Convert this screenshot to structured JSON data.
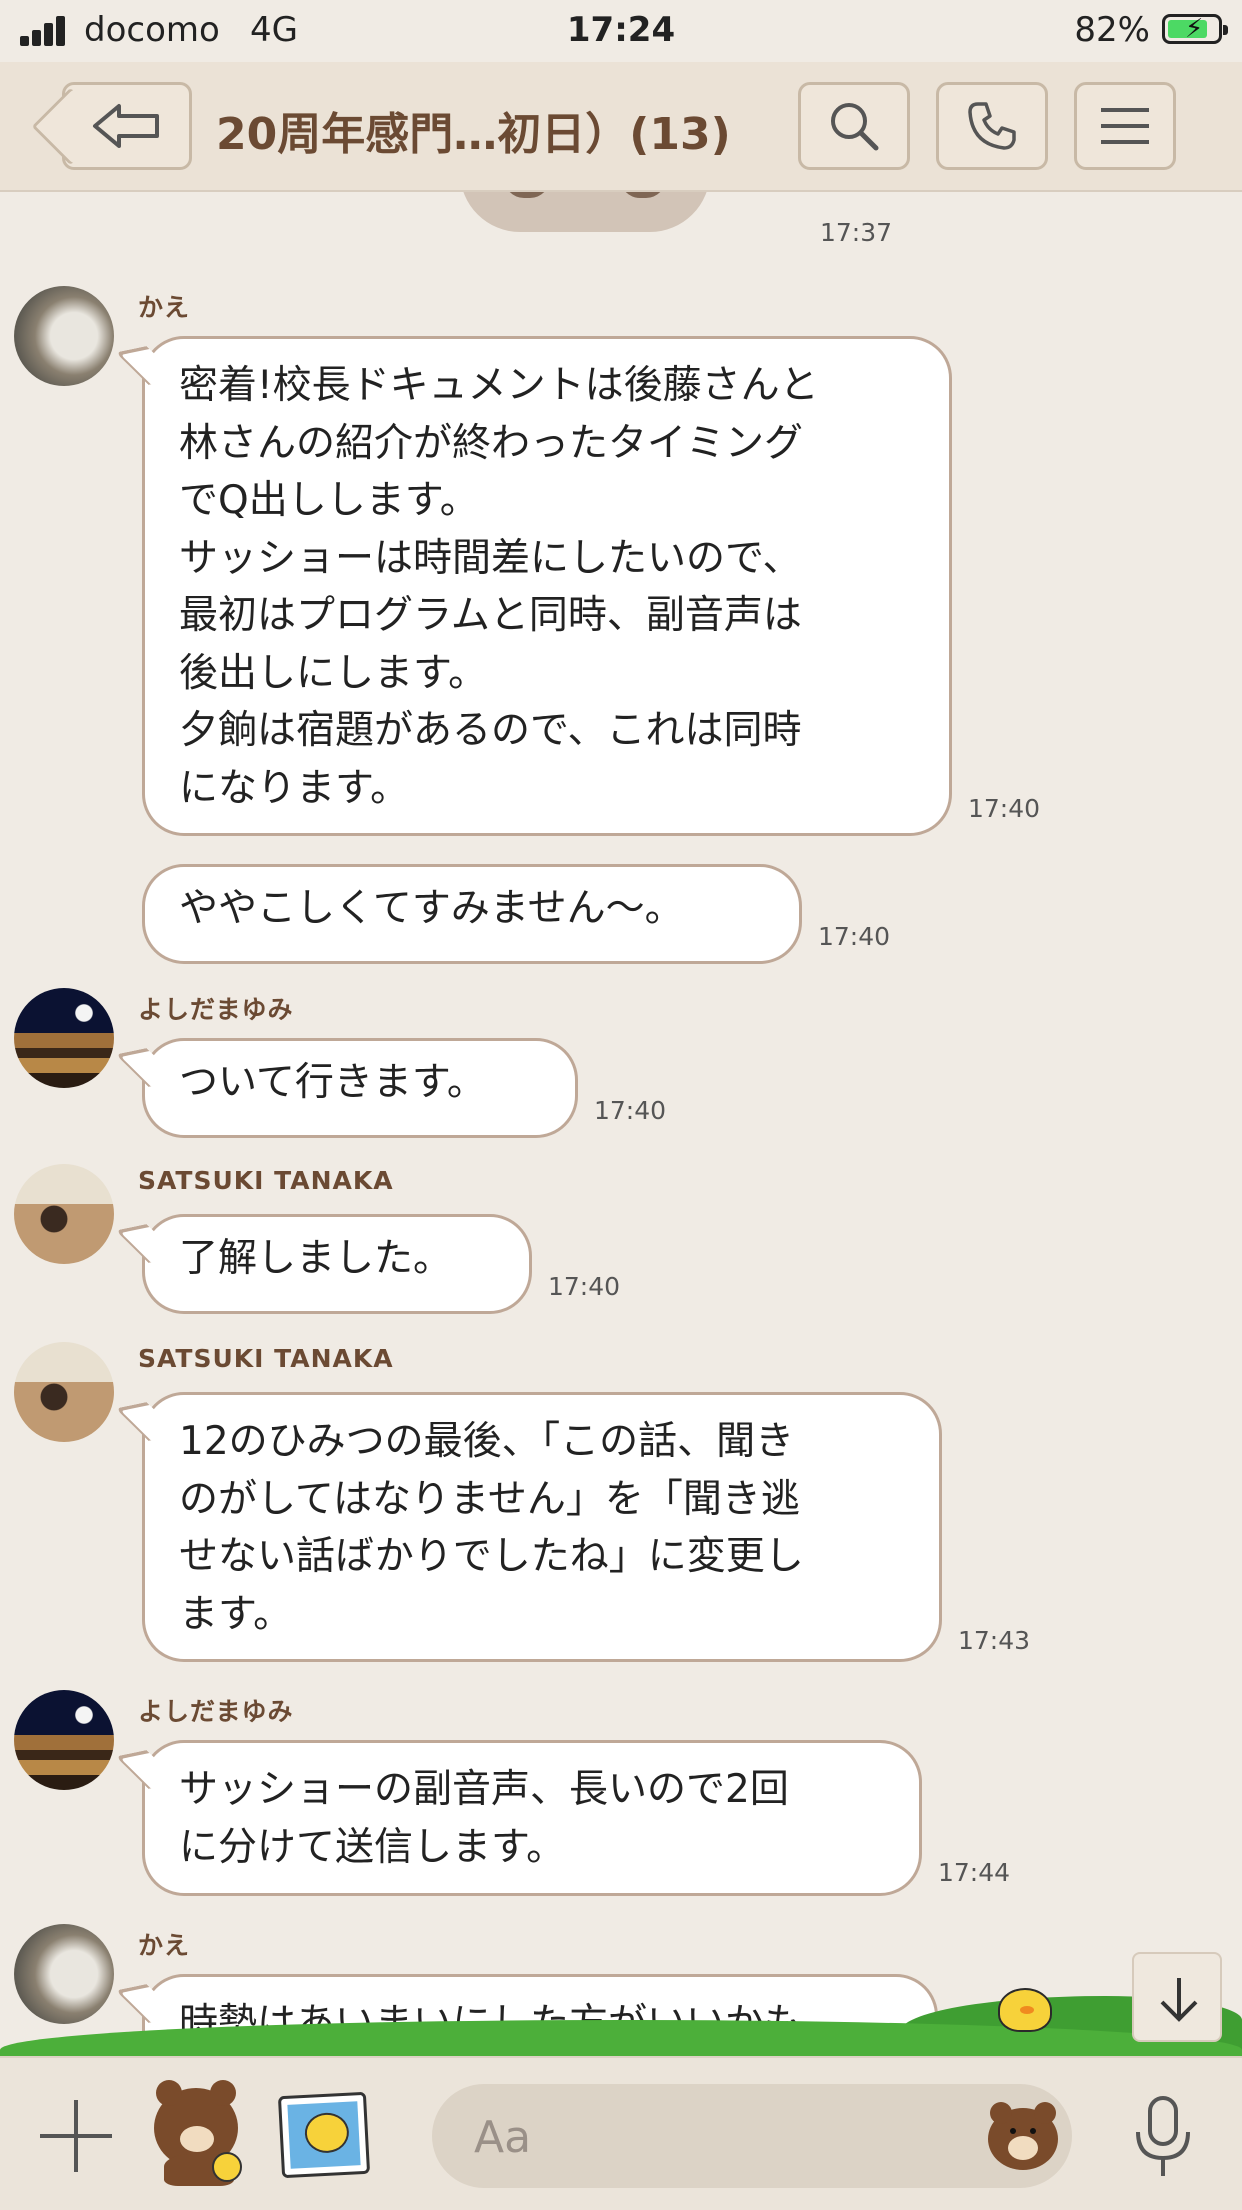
{
  "status_bar": {
    "carrier": "docomo",
    "network": "4G",
    "time": "17:24",
    "battery_percent": "82%",
    "battery_level": 0.82,
    "charging": true
  },
  "header": {
    "title": "20周年感門…初日）(13)",
    "icons": {
      "back": "back-arrow-icon",
      "search": "search-icon",
      "call": "phone-icon",
      "menu": "hamburger-menu-icon"
    }
  },
  "messages": [
    {
      "timestamp": "17:37"
    },
    {
      "sender": "かえ",
      "time": "17:40",
      "text": "密着!校長ドキュメントは後藤さんと\n林さんの紹介が終わったタイミング\nでQ出しします。\nサッショーは時間差にしたいので、\n最初はプログラムと同時、副音声は\n後出しにします。\n夕餉は宿題があるので、これは同時\nになります。"
    },
    {
      "time": "17:40",
      "text": "ややこしくてすみません〜。"
    },
    {
      "sender": "よしだまゆみ",
      "time": "17:40",
      "text": "ついて行きます。"
    },
    {
      "sender": "SATSUKI TANAKA",
      "time": "17:40",
      "text": "了解しました。"
    },
    {
      "sender": "SATSUKI TANAKA",
      "time": "17:43",
      "text": "12のひみつの最後、「この話、聞き\nのがしてはなりません」を「聞き逃\nせない話ばかりでしたね」に変更し\nます。"
    },
    {
      "sender": "よしだまゆみ",
      "time": "17:44",
      "text": "サッショーの副音声、長いので2回\nに分けて送信します。"
    },
    {
      "sender": "かえ",
      "text": "時勢はあいまいにした方がいいかも"
    }
  ],
  "input": {
    "placeholder": "Aa"
  },
  "colors": {
    "background": "#f0ebe4",
    "header": "#ebe2d6",
    "accent_brown": "#6b4a33",
    "bubble_border": "#bfa897",
    "battery_charge": "#4cd964"
  }
}
